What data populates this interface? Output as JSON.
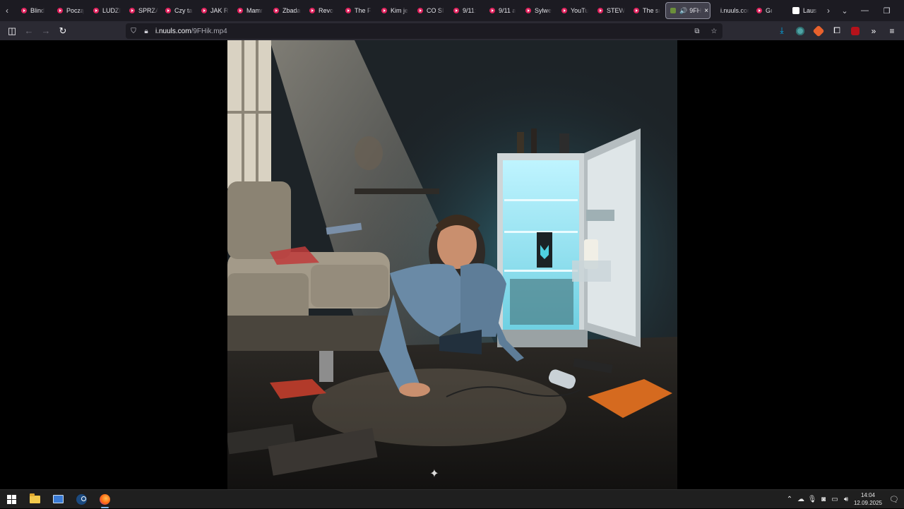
{
  "browser": {
    "tabs": [
      {
        "title": "Blind",
        "favicon": "youtube-icon"
      },
      {
        "title": "Począ",
        "favicon": "youtube-icon"
      },
      {
        "title": "LUDZI",
        "favicon": "youtube-icon"
      },
      {
        "title": "SPRZA",
        "favicon": "youtube-icon"
      },
      {
        "title": "Czy ta",
        "favicon": "youtube-icon"
      },
      {
        "title": "JAK R",
        "favicon": "youtube-icon"
      },
      {
        "title": "Mamr",
        "favicon": "youtube-icon"
      },
      {
        "title": "Zbada",
        "favicon": "youtube-icon"
      },
      {
        "title": "Revo",
        "favicon": "youtube-icon"
      },
      {
        "title": "The F",
        "favicon": "youtube-icon"
      },
      {
        "title": "Kim je",
        "favicon": "youtube-icon"
      },
      {
        "title": "CO SI",
        "favicon": "youtube-icon"
      },
      {
        "title": "9/11:",
        "favicon": "youtube-icon"
      },
      {
        "title": "9/11 a",
        "favicon": "youtube-icon"
      },
      {
        "title": "Sylwe",
        "favicon": "youtube-icon"
      },
      {
        "title": "YouTu",
        "favicon": "youtube-icon"
      },
      {
        "title": "STEW",
        "favicon": "youtube-icon"
      },
      {
        "title": "The sı",
        "favicon": "youtube-icon"
      }
    ],
    "active_tab": {
      "title": "9FH",
      "favicon": "video-icon"
    },
    "tabs_after": [
      {
        "title": "i.nuuls.com",
        "favicon": "none"
      },
      {
        "title": "Gı",
        "favicon": "youtube-icon"
      },
      {
        "title": "Laus",
        "favicon": "wikipedia-icon"
      }
    ],
    "url": {
      "host": "i.nuuls.com",
      "path": "/9FHik.mp4"
    }
  },
  "taskbar": {
    "clock_time": "14:04",
    "clock_date": "12.09.2025"
  },
  "colors": {
    "tabstrip_bg": "#1c1b22",
    "toolbar_bg": "#2b2a33",
    "urlbar_bg": "#1c1b22",
    "accent_blue": "#00b3f4",
    "taskbar_bg": "#1f1f1f"
  }
}
